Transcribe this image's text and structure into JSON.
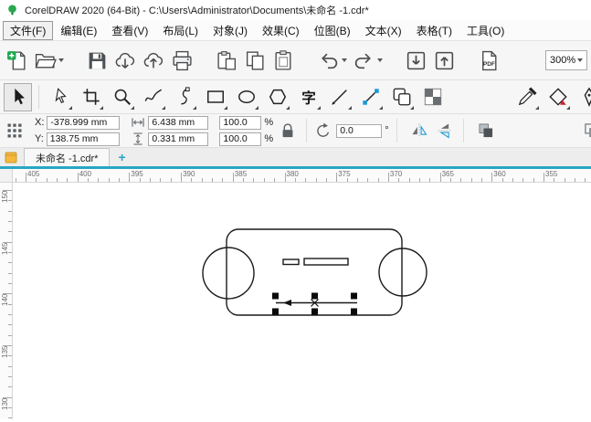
{
  "window": {
    "title": "CorelDRAW 2020 (64-Bit) - C:\\Users\\Administrator\\Documents\\未命名 -1.cdr*"
  },
  "menu_bar": {
    "items": [
      {
        "name": "file",
        "label": "文件(F)",
        "focused": true
      },
      {
        "name": "edit",
        "label": "编辑(E)"
      },
      {
        "name": "view",
        "label": "查看(V)"
      },
      {
        "name": "layout",
        "label": "布局(L)"
      },
      {
        "name": "object",
        "label": "对象(J)"
      },
      {
        "name": "effects",
        "label": "效果(C)"
      },
      {
        "name": "bitmaps",
        "label": "位图(B)"
      },
      {
        "name": "text",
        "label": "文本(X)"
      },
      {
        "name": "table",
        "label": "表格(T)"
      },
      {
        "name": "tools",
        "label": "工具(O)"
      }
    ]
  },
  "standard_toolbar": {
    "zoom_value": "300%",
    "pdf_label": "PDF",
    "buttons": [
      {
        "name": "new-document-button",
        "icon": "new-document"
      },
      {
        "name": "open-document-button",
        "icon": "open-folder",
        "chevron": true
      },
      {
        "name": "save-button",
        "icon": "save",
        "gap": true
      },
      {
        "name": "cloud-download-button",
        "icon": "cloud-down"
      },
      {
        "name": "cloud-upload-button",
        "icon": "cloud-up"
      },
      {
        "name": "print-button",
        "icon": "print"
      },
      {
        "name": "paste-special-button",
        "icon": "paste-special",
        "gap": true
      },
      {
        "name": "copy-button",
        "icon": "copy"
      },
      {
        "name": "paste-button",
        "icon": "paste"
      },
      {
        "name": "undo-button",
        "icon": "undo",
        "chevron": true,
        "gap": true
      },
      {
        "name": "redo-button",
        "icon": "redo",
        "chevron": true
      },
      {
        "name": "import-button",
        "icon": "import",
        "gap": true
      },
      {
        "name": "export-button",
        "icon": "export"
      },
      {
        "name": "pdf-publish-button",
        "icon": "pdf",
        "gap": true
      }
    ]
  },
  "toolbox": {
    "text_tool_glyph": "字",
    "tools": [
      {
        "name": "pick-tool",
        "icon": "pick",
        "selected": true,
        "sepAfter": true
      },
      {
        "name": "shape-tool",
        "icon": "shape",
        "flyout": true
      },
      {
        "name": "crop-tool",
        "icon": "crop",
        "flyout": true
      },
      {
        "name": "zoom-tool",
        "icon": "zoom",
        "flyout": true
      },
      {
        "name": "freehand-tool",
        "icon": "freehand",
        "flyout": true
      },
      {
        "name": "bezier-tool",
        "icon": "bezier",
        "flyout": true
      },
      {
        "name": "rectangle-tool",
        "icon": "rectangle",
        "flyout": true
      },
      {
        "name": "ellipse-tool",
        "icon": "ellipse",
        "flyout": true
      },
      {
        "name": "polygon-tool",
        "icon": "polygon",
        "flyout": true
      },
      {
        "name": "text-tool",
        "icon": "text",
        "flyout": true
      },
      {
        "name": "line-tool",
        "icon": "line",
        "flyout": true
      },
      {
        "name": "connector-tool",
        "icon": "connector",
        "flyout": true
      },
      {
        "name": "contour-tool",
        "icon": "contour",
        "flyout": true
      },
      {
        "name": "transparency-tool",
        "icon": "transparency"
      },
      {
        "name": "eyedropper-tool",
        "icon": "eyedropper",
        "flyout": true,
        "gap": true
      },
      {
        "name": "fill-tool",
        "icon": "fill",
        "flyout": true
      },
      {
        "name": "outline-tool",
        "icon": "outline",
        "flyout": true
      }
    ]
  },
  "property_bar": {
    "x_label": "X:",
    "x_value": "-378.999 mm",
    "y_label": "Y:",
    "y_value": "138.75 mm",
    "width_value": "6.438 mm",
    "height_value": "0.331 mm",
    "scale_h_value": "100.0",
    "scale_v_value": "100.0",
    "percent_sign": "%",
    "rotation_value": "0.0",
    "degree_sign": "°"
  },
  "document_tabs": {
    "active_tab_label": "未命名 -1.cdr*",
    "new_tab_label": "+"
  },
  "rulers": {
    "horizontal_labels": [
      "405",
      "400",
      "395",
      "390",
      "385",
      "380",
      "375",
      "370",
      "365",
      "360",
      "355"
    ],
    "vertical_labels": [
      "150",
      "145",
      "140",
      "135",
      "130"
    ]
  },
  "colors": {
    "accent_teal": "#29a6c4",
    "selection_black": "#111111",
    "drawing_stroke": "#1a1a1a"
  }
}
